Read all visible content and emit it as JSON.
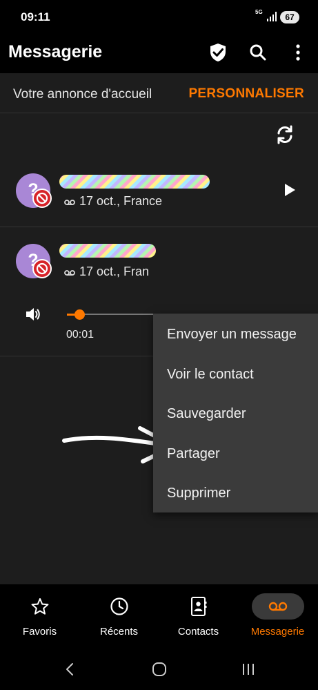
{
  "status_bar": {
    "time": "09:11",
    "network": "5G",
    "battery": "67"
  },
  "app_bar": {
    "title": "Messagerie",
    "icons": [
      "shield-check-icon",
      "search-icon",
      "more-vert-icon"
    ]
  },
  "greeting": {
    "label": "Votre annonce d'accueil",
    "action": "PERSONNALISER"
  },
  "messages": [
    {
      "avatar": "?",
      "meta": "17 oct., France"
    },
    {
      "avatar": "?",
      "meta": "17 oct., Fran"
    }
  ],
  "player": {
    "elapsed": "00:01",
    "progress": 0.13
  },
  "context_menu": {
    "items": [
      "Envoyer un message",
      "Voir le contact",
      "Sauvegarder",
      "Partager",
      "Supprimer"
    ]
  },
  "bottom_nav": {
    "items": [
      {
        "label": "Favoris",
        "icon": "star-icon"
      },
      {
        "label": "Récents",
        "icon": "clock-icon"
      },
      {
        "label": "Contacts",
        "icon": "contacts-book-icon"
      },
      {
        "label": "Messagerie",
        "icon": "voicemail-icon",
        "active": true
      }
    ]
  },
  "colors": {
    "accent": "#ff7900",
    "surface": "#1d1d1d",
    "menu": "#3b3b3b",
    "avatar": "#a987d6",
    "block": "#d6232a"
  }
}
